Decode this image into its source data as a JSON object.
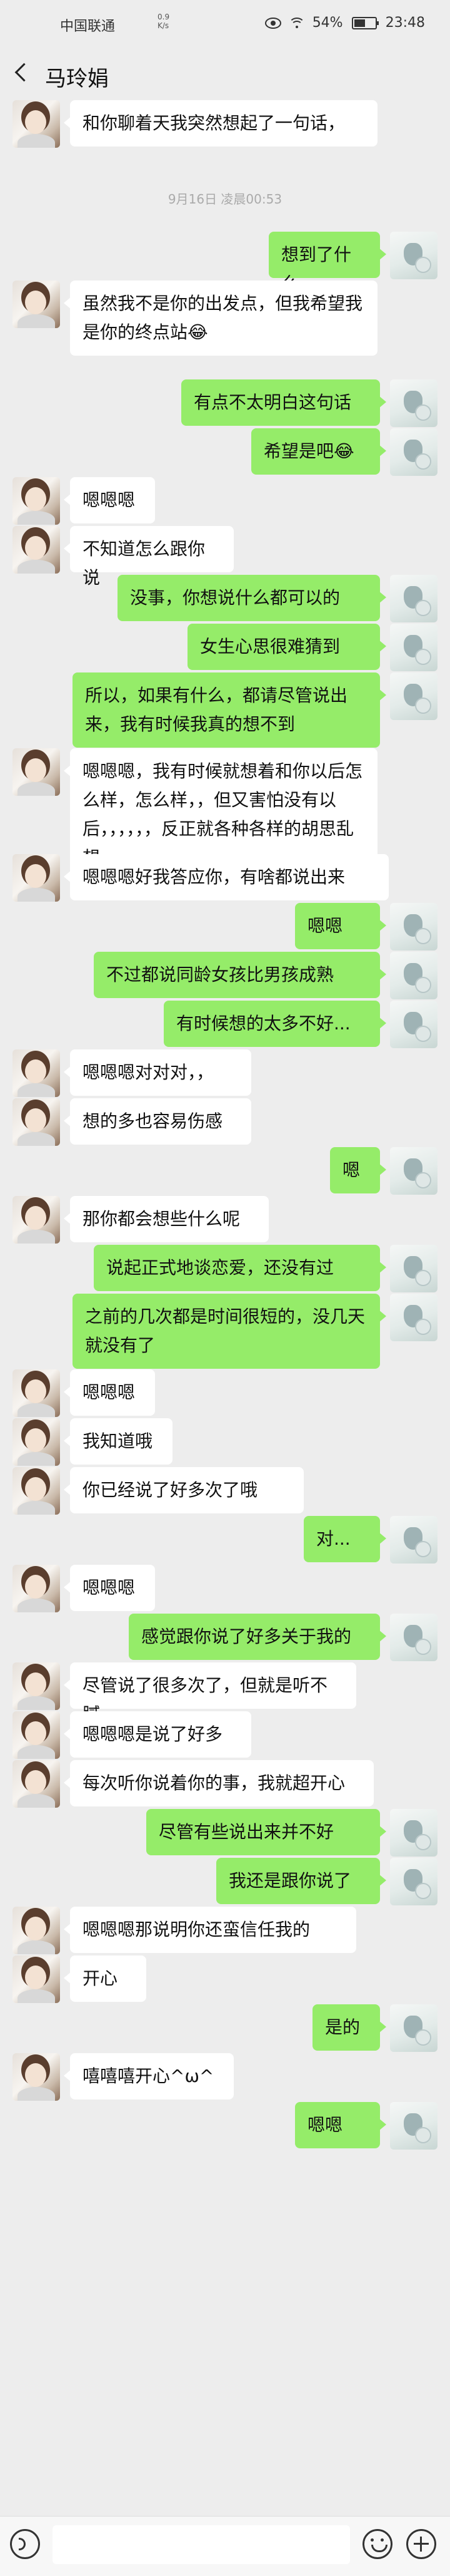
{
  "status_bar": {
    "carrier": "中国联通",
    "net_speed": "0.9",
    "net_unit": "K/s",
    "battery": "54%",
    "battery_level": 0.54,
    "time": "23:48"
  },
  "header": {
    "title": "马玲娟"
  },
  "timestamp": "9月16日 凌晨00:53",
  "messages": [
    {
      "from": "her",
      "text": "和你聊着天我突然想起了一句话，"
    },
    {
      "from": "me",
      "text": "想到了什么"
    },
    {
      "from": "her",
      "text": "虽然我不是你的出发点，但我希望我是你的终点站😂"
    },
    {
      "from": "me",
      "text": "有点不太明白这句话"
    },
    {
      "from": "me",
      "text": "希望是吧😂"
    },
    {
      "from": "her",
      "text": "嗯嗯嗯"
    },
    {
      "from": "her",
      "text": "不知道怎么跟你说"
    },
    {
      "from": "me",
      "text": "没事，你想说什么都可以的"
    },
    {
      "from": "me",
      "text": "女生心思很难猜到"
    },
    {
      "from": "me",
      "text": "所以，如果有什么，都请尽管说出来，我有时候我真的想不到"
    },
    {
      "from": "her",
      "text": "嗯嗯嗯，我有时候就想着和你以后怎么样，怎么样，，但又害怕没有以后，，，，，，反正就各种各样的胡思乱想"
    },
    {
      "from": "her",
      "text": "嗯嗯嗯好我答应你，有啥都说出来"
    },
    {
      "from": "me",
      "text": "嗯嗯"
    },
    {
      "from": "me",
      "text": "不过都说同龄女孩比男孩成熟"
    },
    {
      "from": "me",
      "text": "有时候想的太多不好..."
    },
    {
      "from": "her",
      "text": "嗯嗯嗯对对对，，"
    },
    {
      "from": "her",
      "text": "想的多也容易伤感"
    },
    {
      "from": "me",
      "text": "嗯"
    },
    {
      "from": "her",
      "text": "那你都会想些什么呢"
    },
    {
      "from": "me",
      "text": "说起正式地谈恋爱，还没有过"
    },
    {
      "from": "me",
      "text": "之前的几次都是时间很短的，没几天就没有了"
    },
    {
      "from": "her",
      "text": "嗯嗯嗯"
    },
    {
      "from": "her",
      "text": "我知道哦"
    },
    {
      "from": "her",
      "text": "你已经说了好多次了哦"
    },
    {
      "from": "me",
      "text": "对..."
    },
    {
      "from": "her",
      "text": "嗯嗯嗯"
    },
    {
      "from": "me",
      "text": "感觉跟你说了好多关于我的"
    },
    {
      "from": "her",
      "text": "尽管说了很多次了，但就是听不腻，"
    },
    {
      "from": "her",
      "text": "嗯嗯嗯是说了好多"
    },
    {
      "from": "her",
      "text": "每次听你说着你的事，我就超开心"
    },
    {
      "from": "me",
      "text": "尽管有些说出来并不好"
    },
    {
      "from": "me",
      "text": "我还是跟你说了"
    },
    {
      "from": "her",
      "text": "嗯嗯嗯那说明你还蛮信任我的"
    },
    {
      "from": "her",
      "text": "开心"
    },
    {
      "from": "me",
      "text": "是的"
    },
    {
      "from": "her",
      "text": "嘻嘻嘻开心^ω^"
    },
    {
      "from": "me",
      "text": "嗯嗯"
    }
  ],
  "input": {
    "value": "",
    "placeholder": ""
  },
  "colors": {
    "background": "#ededed",
    "my_bubble": "#95ec69",
    "her_bubble": "#ffffff"
  }
}
